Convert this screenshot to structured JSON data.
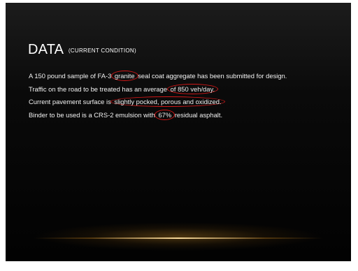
{
  "slide": {
    "title": "DATA",
    "subtitle": "(CURRENT CONDITION)",
    "lines": [
      {
        "before": "A 150 pound sample of FA-3",
        "circled": "granite",
        "after": "seal coat aggregate has been submitted for design."
      },
      {
        "before": "Traffic on the road to be treated has an average",
        "circled": "of 850 veh/day.",
        "after": ""
      },
      {
        "before": "Current pavement surface is",
        "circled": "slightly pocked, porous and oxidized.",
        "after": ""
      },
      {
        "before": "Binder to be used is a CRS-2 emulsion with",
        "circled": "67%",
        "after": "residual asphalt."
      }
    ]
  },
  "colors": {
    "background": "#050505",
    "text": "#ffffff",
    "annotation": "#d01818",
    "glow": "#f6d89a"
  }
}
